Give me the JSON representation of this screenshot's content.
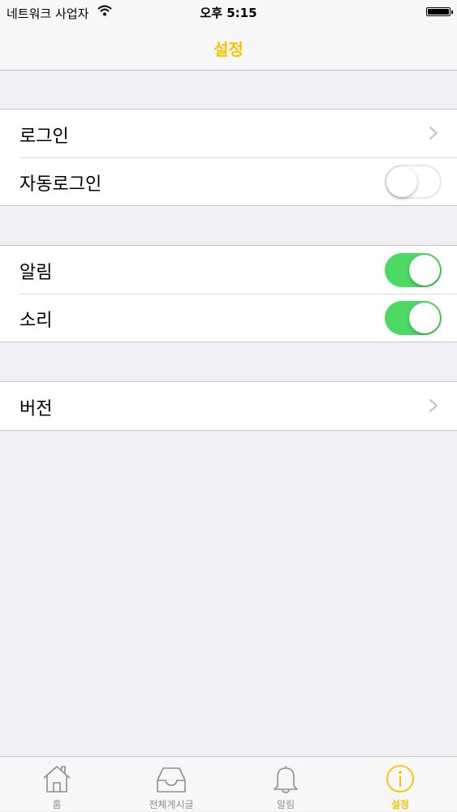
{
  "status_bar": {
    "carrier": "네트워크 사업자",
    "time": "오후 5:15",
    "wifi_icon": "wifi-icon",
    "battery_icon": "battery-icon"
  },
  "nav": {
    "title": "설정"
  },
  "sections": [
    {
      "rows": [
        {
          "label": "로그인",
          "accessory": "chevron"
        },
        {
          "label": "자동로그인",
          "accessory": "toggle",
          "on": false
        }
      ]
    },
    {
      "rows": [
        {
          "label": "알림",
          "accessory": "toggle",
          "on": true
        },
        {
          "label": "소리",
          "accessory": "toggle",
          "on": true
        }
      ]
    },
    {
      "rows": [
        {
          "label": "버전",
          "accessory": "chevron"
        }
      ]
    }
  ],
  "tabs": [
    {
      "label": "홈",
      "icon": "home-icon",
      "active": false
    },
    {
      "label": "전체게시글",
      "icon": "inbox-tray-icon",
      "active": false
    },
    {
      "label": "알림",
      "icon": "bell-icon",
      "active": false
    },
    {
      "label": "설정",
      "icon": "info-circle-icon",
      "active": true
    }
  ],
  "colors": {
    "accent": "#f5c400",
    "toggle_on": "#4cd964",
    "background": "#efeff4",
    "tab_inactive": "#8e8e93"
  }
}
